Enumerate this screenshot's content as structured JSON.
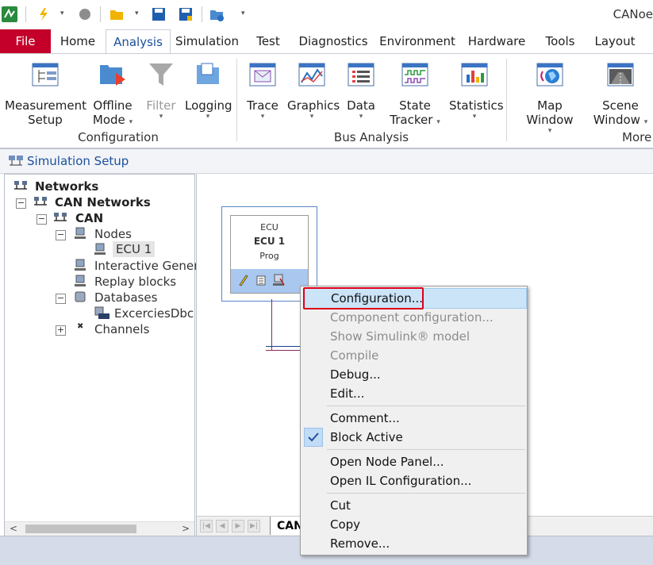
{
  "app": {
    "title": "CANoe"
  },
  "tabs": [
    {
      "label": "File"
    },
    {
      "label": "Home"
    },
    {
      "label": "Analysis"
    },
    {
      "label": "Simulation"
    },
    {
      "label": "Test"
    },
    {
      "label": "Diagnostics"
    },
    {
      "label": "Environment"
    },
    {
      "label": "Hardware"
    },
    {
      "label": "Tools"
    },
    {
      "label": "Layout"
    }
  ],
  "ribbon": {
    "buttons": [
      {
        "line1": "Measurement",
        "line2": "Setup"
      },
      {
        "line1": "Offline",
        "line2": "Mode"
      },
      {
        "line1": "Filter"
      },
      {
        "line1": "Logging"
      },
      {
        "line1": "Trace"
      },
      {
        "line1": "Graphics"
      },
      {
        "line1": "Data"
      },
      {
        "line1": "State",
        "line2": "Tracker"
      },
      {
        "line1": "Statistics"
      },
      {
        "line1": "Map Window"
      },
      {
        "line1": "Scene",
        "line2": "Window"
      }
    ],
    "groups": {
      "configuration": "Configuration",
      "bus_analysis": "Bus Analysis",
      "more": "More"
    }
  },
  "sim": {
    "title": "Simulation Setup",
    "tree": {
      "networks": "Networks",
      "can_networks": "CAN Networks",
      "can": "CAN",
      "nodes": "Nodes",
      "ecu1": "ECU 1",
      "interactive": "Interactive Generat...",
      "replay": "Replay blocks",
      "databases": "Databases",
      "dbc": "ExcerciesDbc",
      "channels": "Channels"
    },
    "ecu": {
      "type": "ECU",
      "name": "ECU 1",
      "sub": "Prog"
    },
    "sheet_tab": "CAN"
  },
  "context_menu": {
    "items": [
      {
        "label": "Configuration...",
        "state": "highlighted"
      },
      {
        "label": "Component configuration...",
        "state": "disabled"
      },
      {
        "label": "Show Simulink® model",
        "state": "disabled"
      },
      {
        "label": "Compile",
        "state": "disabled"
      },
      {
        "label": "Debug...",
        "state": "normal"
      },
      {
        "label": "Edit...",
        "state": "normal"
      },
      {
        "label": "Comment...",
        "state": "normal"
      },
      {
        "label": "Block Active",
        "state": "checked"
      },
      {
        "label": "Open Node Panel...",
        "state": "normal"
      },
      {
        "label": "Open IL Configuration...",
        "state": "normal"
      },
      {
        "label": "Cut",
        "state": "normal"
      },
      {
        "label": "Copy",
        "state": "normal"
      },
      {
        "label": "Remove...",
        "state": "normal"
      }
    ]
  },
  "colors": {
    "file_tab": "#c4002a",
    "accent": "#1a4f9c",
    "highlight_box": "#e0001a",
    "menu_hover": "#cbe4f7"
  }
}
